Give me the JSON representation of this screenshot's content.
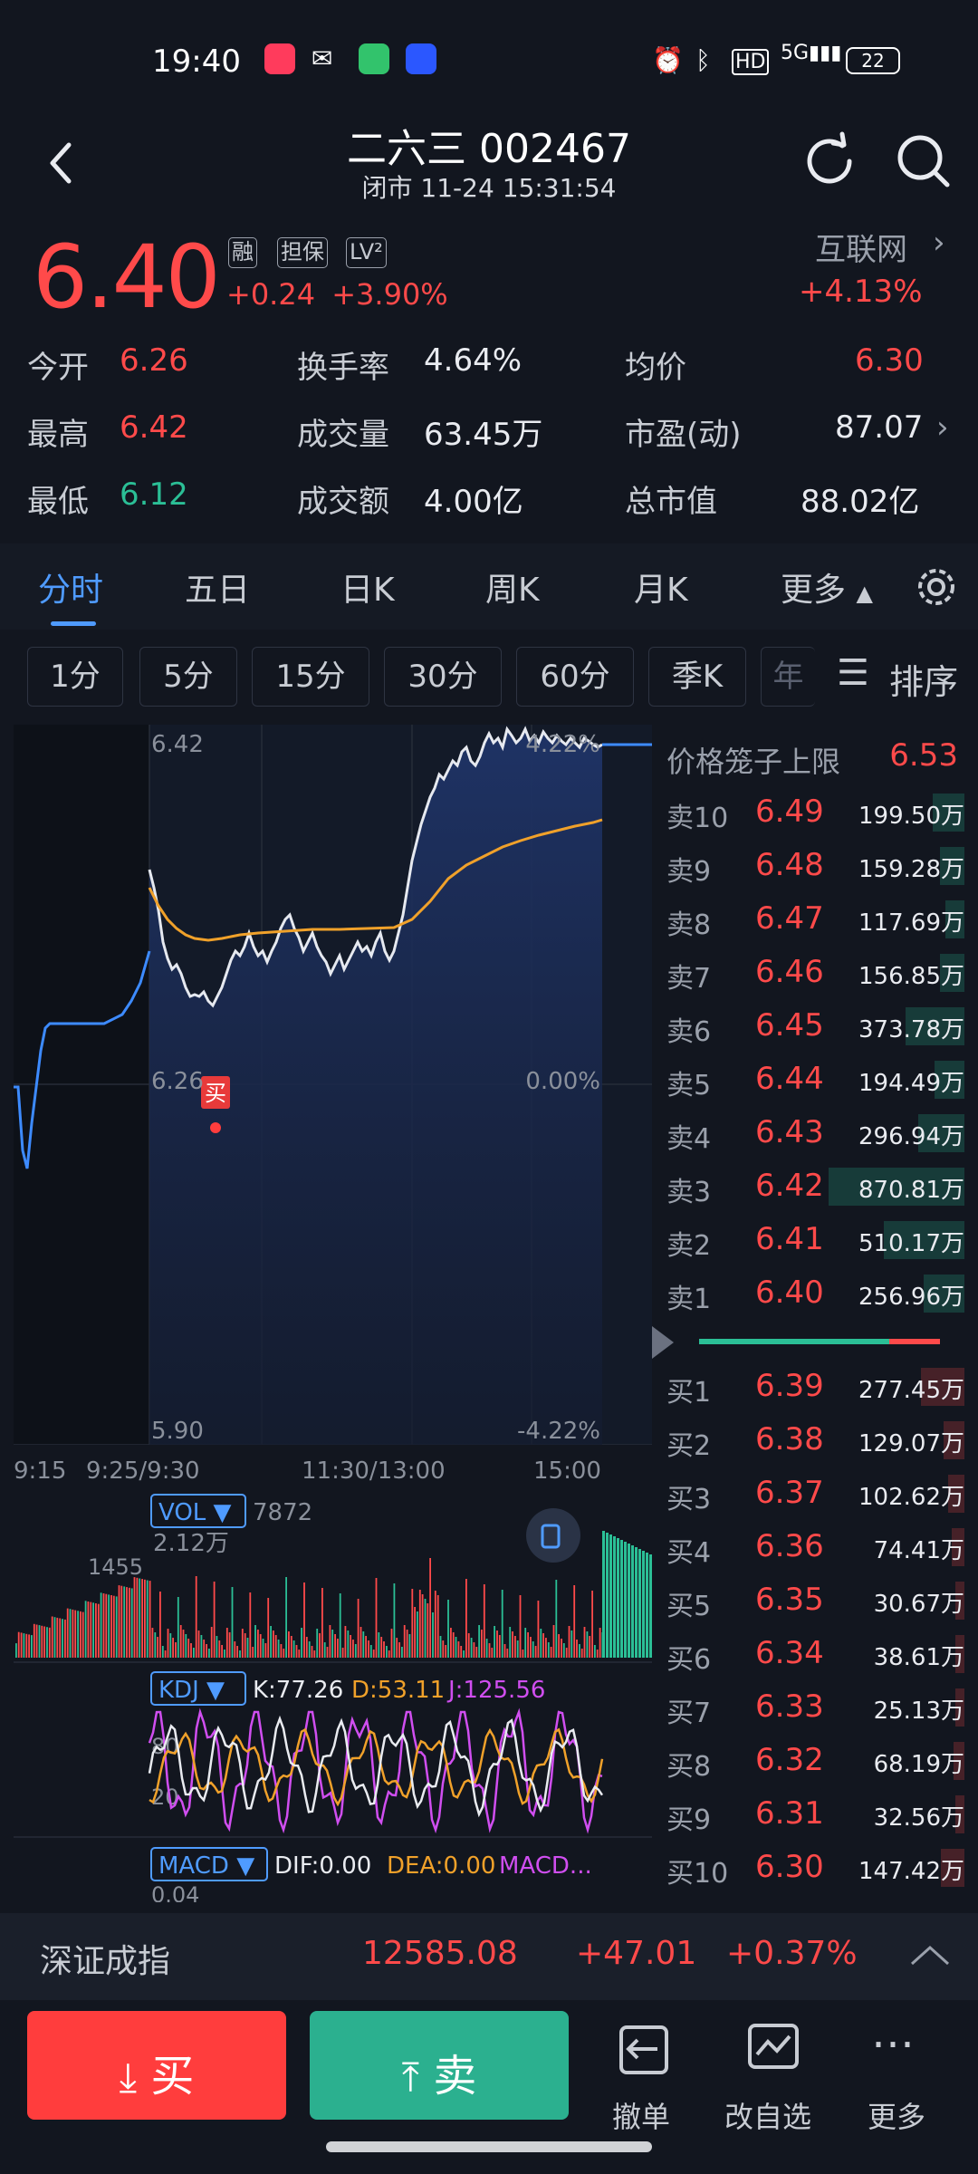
{
  "status_bar": {
    "time": "19:40",
    "network": "5G",
    "battery": "22"
  },
  "header": {
    "title": "二六三 002467",
    "subtitle": "闭市 11-24 15:31:54"
  },
  "quote": {
    "price": "6.40",
    "tags": [
      "融",
      "担保",
      "LV²"
    ],
    "change": "+0.24",
    "change_pct": "+3.90%",
    "sector": "互联网",
    "sector_pct": "+4.13%"
  },
  "stats": [
    {
      "label": "今开",
      "value": "6.26",
      "color": "#ff4a4a"
    },
    {
      "label": "换手率",
      "value": "4.64%",
      "color": "#e9ebf0"
    },
    {
      "label": "均价",
      "value": "6.30",
      "color": "#ff4a4a"
    },
    {
      "label": "最高",
      "value": "6.42",
      "color": "#ff4a4a"
    },
    {
      "label": "成交量",
      "value": "63.45万",
      "color": "#e9ebf0"
    },
    {
      "label": "市盈(动)",
      "value": "87.07",
      "color": "#e9ebf0"
    },
    {
      "label": "最低",
      "value": "6.12",
      "color": "#2bbf96"
    },
    {
      "label": "成交额",
      "value": "4.00亿",
      "color": "#e9ebf0"
    },
    {
      "label": "总市值",
      "value": "88.02亿",
      "color": "#e9ebf0"
    }
  ],
  "tabs": [
    "分时",
    "五日",
    "日K",
    "周K",
    "月K",
    "更多"
  ],
  "periods": [
    "1分",
    "5分",
    "15分",
    "30分",
    "60分",
    "季K",
    "年"
  ],
  "sort_label": "排序",
  "chart": {
    "y_top": "6.42",
    "y_mid_left": "6.26",
    "y_bottom": "5.90",
    "pct_top": "4.22%",
    "pct_mid": "0.00%",
    "pct_bottom": "-4.22%",
    "x_labels": [
      "9:15",
      "9:25/9:30",
      "11:30/13:00",
      "15:00"
    ],
    "buy_marker": "买",
    "vol": {
      "label": "VOL",
      "value": "7872",
      "max": "2.12万",
      "aux": "1455"
    },
    "kdj": {
      "label": "KDJ",
      "k": "K:77.26",
      "d": "D:53.11",
      "j": "J:125.56",
      "lvl80": "80",
      "lvl20": "20"
    },
    "macd": {
      "label": "MACD",
      "dif": "DIF:0.00",
      "dea": "DEA:0.00",
      "macd": "MACD...",
      "val": "0.04"
    }
  },
  "orderbook": {
    "limit_label": "价格笼子上限",
    "limit_value": "6.53",
    "asks": [
      {
        "label": "卖10",
        "price": "6.49",
        "vol": "199.50万",
        "w": 0.23
      },
      {
        "label": "卖9",
        "price": "6.48",
        "vol": "159.28万",
        "w": 0.18
      },
      {
        "label": "卖8",
        "price": "6.47",
        "vol": "117.69万",
        "w": 0.14
      },
      {
        "label": "卖7",
        "price": "6.46",
        "vol": "156.85万",
        "w": 0.18
      },
      {
        "label": "卖6",
        "price": "6.45",
        "vol": "373.78万",
        "w": 0.43
      },
      {
        "label": "卖5",
        "price": "6.44",
        "vol": "194.49万",
        "w": 0.22
      },
      {
        "label": "卖4",
        "price": "6.43",
        "vol": "296.94万",
        "w": 0.34
      },
      {
        "label": "卖3",
        "price": "6.42",
        "vol": "870.81万",
        "w": 1.0
      },
      {
        "label": "卖2",
        "price": "6.41",
        "vol": "510.17万",
        "w": 0.59
      },
      {
        "label": "卖1",
        "price": "6.40",
        "vol": "256.96万",
        "w": 0.3
      }
    ],
    "bids": [
      {
        "label": "买1",
        "price": "6.39",
        "vol": "277.45万",
        "w": 0.32
      },
      {
        "label": "买2",
        "price": "6.38",
        "vol": "129.07万",
        "w": 0.15
      },
      {
        "label": "买3",
        "price": "6.37",
        "vol": "102.62万",
        "w": 0.12
      },
      {
        "label": "买4",
        "price": "6.36",
        "vol": "74.41万",
        "w": 0.09
      },
      {
        "label": "买5",
        "price": "6.35",
        "vol": "30.67万",
        "w": 0.04
      },
      {
        "label": "买6",
        "price": "6.34",
        "vol": "38.61万",
        "w": 0.05
      },
      {
        "label": "买7",
        "price": "6.33",
        "vol": "25.13万",
        "w": 0.03
      },
      {
        "label": "买8",
        "price": "6.32",
        "vol": "68.19万",
        "w": 0.08
      },
      {
        "label": "买9",
        "price": "6.31",
        "vol": "32.56万",
        "w": 0.04
      },
      {
        "label": "买10",
        "price": "6.30",
        "vol": "147.42万",
        "w": 0.17
      }
    ]
  },
  "index": {
    "name": "深证成指",
    "value": "12585.08",
    "change": "+47.01",
    "pct": "+0.37%"
  },
  "actions": {
    "buy": "买",
    "sell": "卖",
    "cancel": "撤单",
    "watch": "改自选",
    "more": "更多"
  },
  "colors": {
    "up": "#ff4a4a",
    "down": "#2bbf96",
    "accent": "#4f9bff",
    "avg_line": "#f0a12a"
  }
}
